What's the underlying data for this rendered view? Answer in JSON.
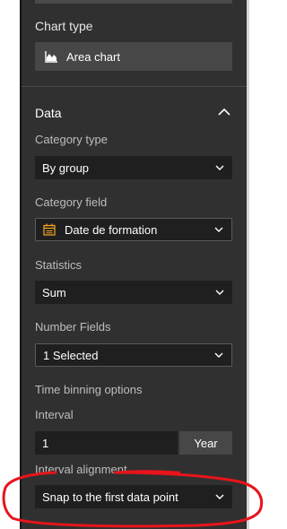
{
  "chart_type": {
    "label": "Chart type",
    "value": "Area chart",
    "icon": "area-chart-icon"
  },
  "data_section": {
    "title": "Data",
    "category_type": {
      "label": "Category type",
      "value": "By group"
    },
    "category_field": {
      "label": "Category field",
      "value": "Date de formation",
      "icon": "calendar-icon"
    },
    "statistics": {
      "label": "Statistics",
      "value": "Sum"
    },
    "number_fields": {
      "label": "Number Fields",
      "value": "1 Selected"
    },
    "time_binning": {
      "label": "Time binning options",
      "interval_label": "Interval",
      "interval_value": "1",
      "interval_unit": "Year",
      "alignment_label": "Interval alignment",
      "alignment_value": "Snap to the first data point"
    }
  },
  "colors": {
    "panel_bg": "#303030",
    "input_bg": "#1f1f1f",
    "button_bg": "#474747",
    "accent_orange": "#f5a623",
    "annotation_red": "#e8141b"
  }
}
